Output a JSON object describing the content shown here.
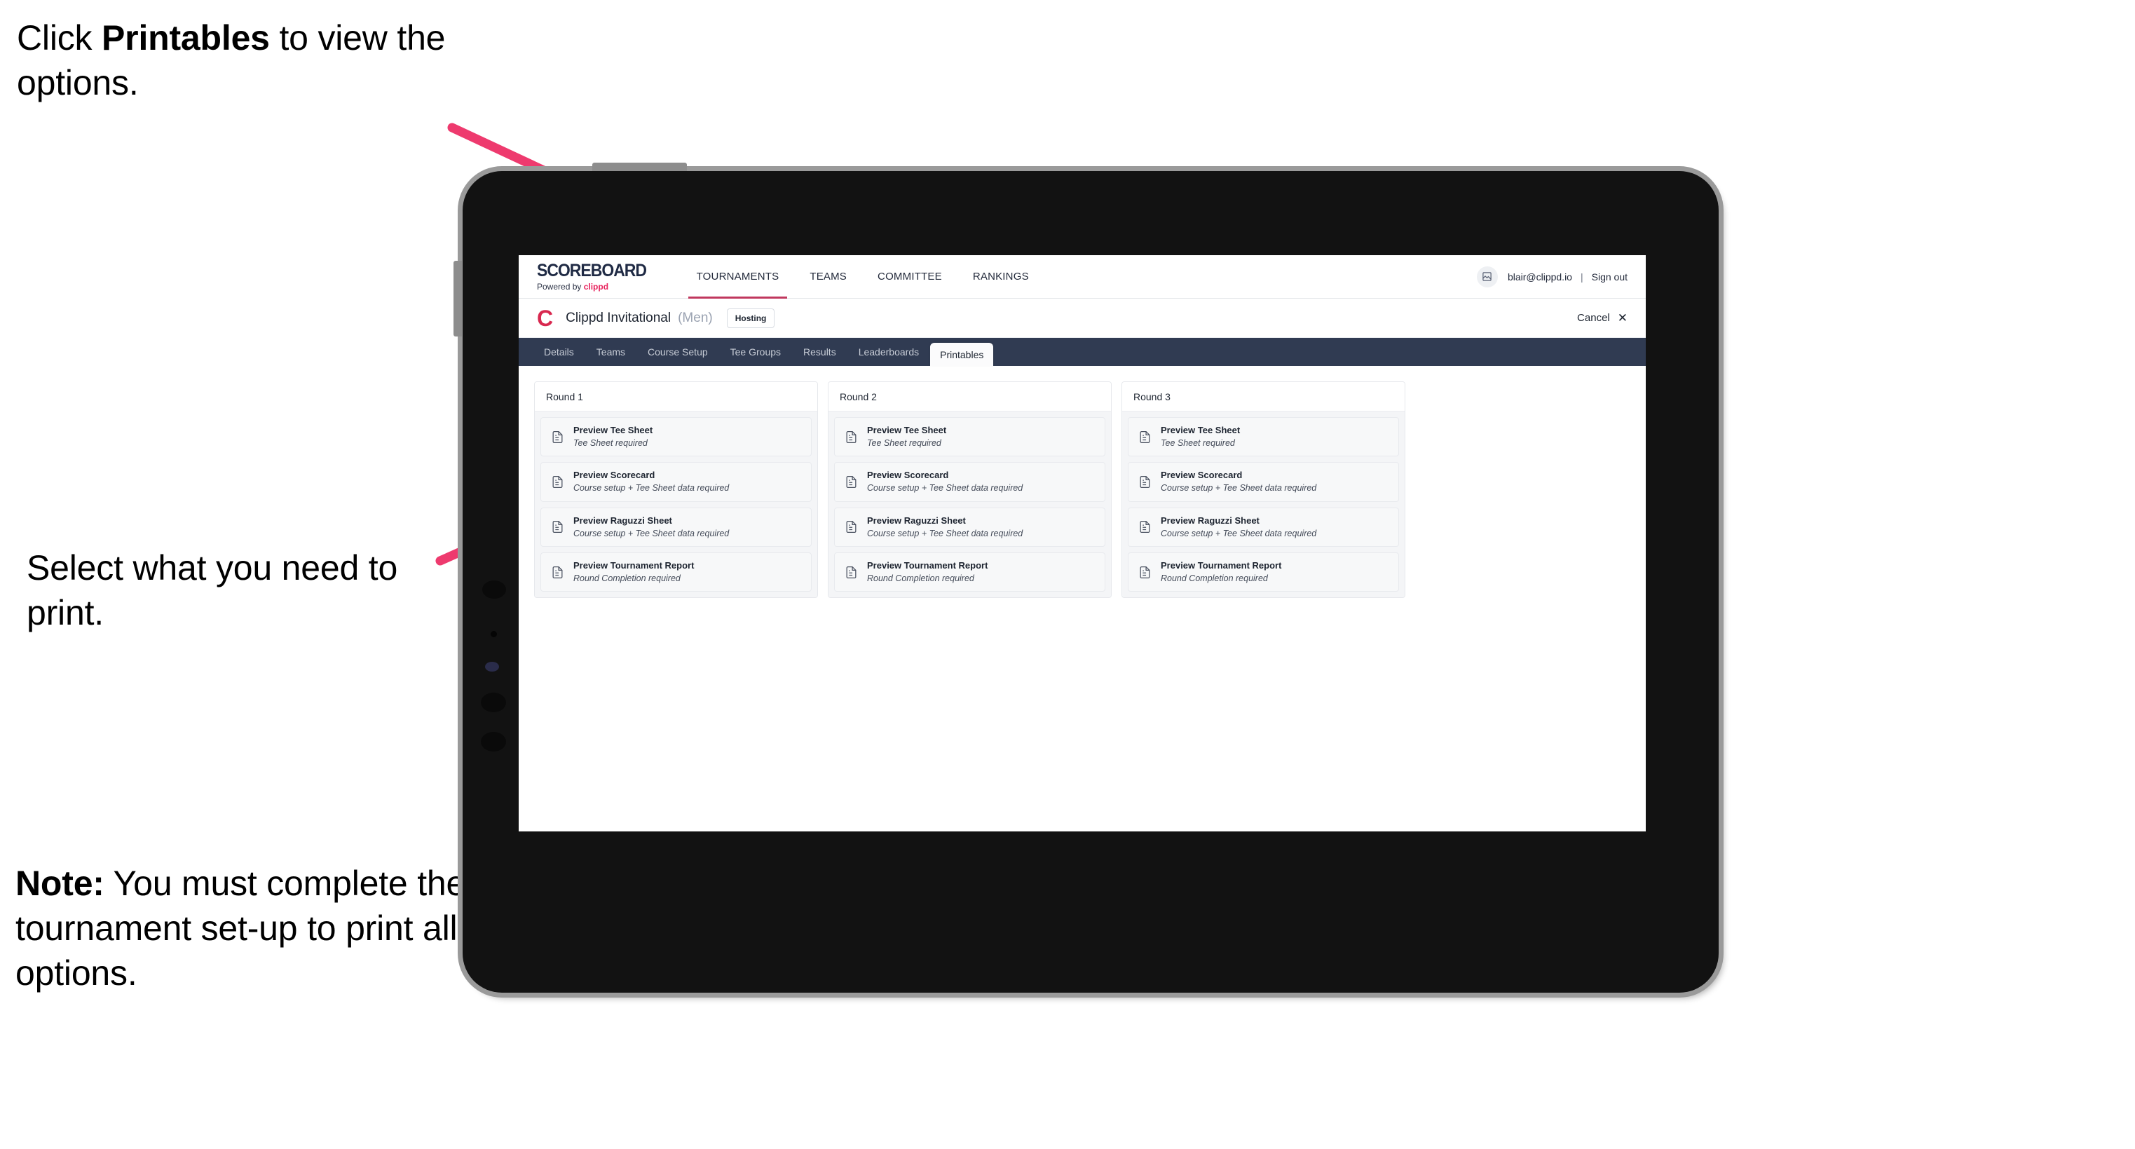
{
  "annotations": {
    "click_prefix": "Click ",
    "click_bold": "Printables",
    "click_suffix": " to view the options.",
    "select": "Select what you need to print.",
    "note_bold": "Note:",
    "note_rest": " You must complete the tournament set-up to print all the options.",
    "arrow_color": "#ee3a6e"
  },
  "device": {
    "name": "tablet-device",
    "frame_color": "#121212",
    "bezel_color": "#9a9a9a"
  },
  "app": {
    "brand": {
      "word": "SCOREBOARD",
      "powered_by": "Powered by ",
      "powered_brand": "clippd"
    },
    "topnav": [
      {
        "label": "TOURNAMENTS",
        "active": true
      },
      {
        "label": "TEAMS",
        "active": false
      },
      {
        "label": "COMMITTEE",
        "active": false
      },
      {
        "label": "RANKINGS",
        "active": false
      }
    ],
    "account": {
      "avatar_icon": "user-image-icon",
      "email": "blair@clippd.io",
      "separator": "|",
      "sign_out": "Sign out"
    },
    "tournament": {
      "mark": "C",
      "name": "Clippd Invitational",
      "gender": "(Men)",
      "status_badge": "Hosting",
      "cancel_label": "Cancel",
      "cancel_icon": "close-x-icon"
    },
    "subtabs": [
      {
        "label": "Details",
        "active": false
      },
      {
        "label": "Teams",
        "active": false
      },
      {
        "label": "Course Setup",
        "active": false
      },
      {
        "label": "Tee Groups",
        "active": false
      },
      {
        "label": "Results",
        "active": false
      },
      {
        "label": "Leaderboards",
        "active": false
      },
      {
        "label": "Printables",
        "active": true
      }
    ],
    "rounds": [
      {
        "header": "Round 1",
        "items": [
          {
            "icon": "document-icon",
            "title": "Preview Tee Sheet",
            "subtitle": "Tee Sheet required"
          },
          {
            "icon": "document-icon",
            "title": "Preview Scorecard",
            "subtitle": "Course setup + Tee Sheet data required"
          },
          {
            "icon": "document-icon",
            "title": "Preview Raguzzi Sheet",
            "subtitle": "Course setup + Tee Sheet data required"
          },
          {
            "icon": "document-icon",
            "title": "Preview Tournament Report",
            "subtitle": "Round Completion required"
          }
        ]
      },
      {
        "header": "Round 2",
        "items": [
          {
            "icon": "document-icon",
            "title": "Preview Tee Sheet",
            "subtitle": "Tee Sheet required"
          },
          {
            "icon": "document-icon",
            "title": "Preview Scorecard",
            "subtitle": "Course setup + Tee Sheet data required"
          },
          {
            "icon": "document-icon",
            "title": "Preview Raguzzi Sheet",
            "subtitle": "Course setup + Tee Sheet data required"
          },
          {
            "icon": "document-icon",
            "title": "Preview Tournament Report",
            "subtitle": "Round Completion required"
          }
        ]
      },
      {
        "header": "Round 3",
        "items": [
          {
            "icon": "document-icon",
            "title": "Preview Tee Sheet",
            "subtitle": "Tee Sheet required"
          },
          {
            "icon": "document-icon",
            "title": "Preview Scorecard",
            "subtitle": "Course setup + Tee Sheet data required"
          },
          {
            "icon": "document-icon",
            "title": "Preview Raguzzi Sheet",
            "subtitle": "Course setup + Tee Sheet data required"
          },
          {
            "icon": "document-icon",
            "title": "Preview Tournament Report",
            "subtitle": "Round Completion required"
          }
        ]
      }
    ],
    "colors": {
      "accent_pink": "#e8255f",
      "subtab_bar": "#303b52",
      "brand_navy": "#1f2a44"
    }
  }
}
